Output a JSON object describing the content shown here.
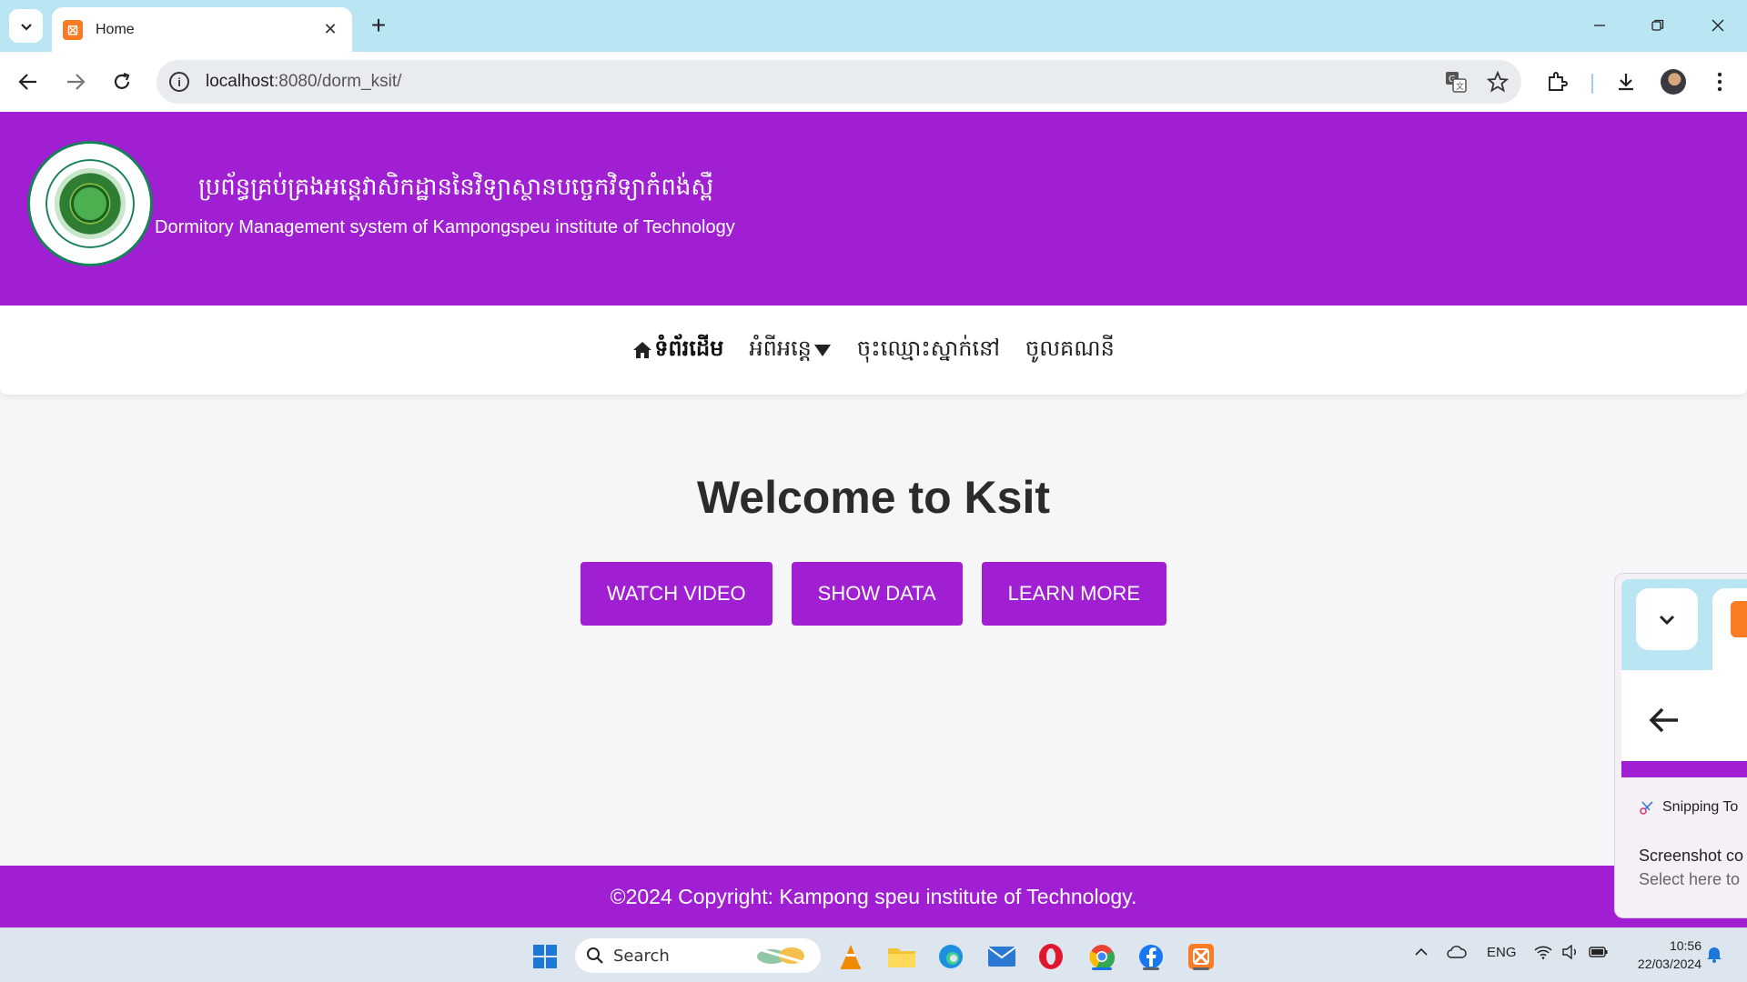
{
  "browser": {
    "tab_title": "Home",
    "url_host": "localhost",
    "url_rest": ":8080/dorm_ksit/",
    "new_tab_glyph": "+",
    "close_glyph": "✕",
    "info_glyph": "i",
    "favicon_glyph": "⊠"
  },
  "site": {
    "title_km": "ប្រព័ន្ធគ្រប់គ្រងអន្តេវាសិកដ្ឋាននៃវិទ្យាស្ថានបច្ចេកវិទ្យាកំពង់ស្ពឺ",
    "title_en": "Dormitory Management system of Kampongspeu institute of Technology",
    "accent_color": "#a11fd3"
  },
  "nav": {
    "home": "ទំព័រដើម",
    "about": "អំពីអន្តេ",
    "register": "ចុះឈ្មោះស្នាក់នៅ",
    "login": "ចូលគណនី"
  },
  "main": {
    "welcome": "Welcome to Ksit",
    "buttons": [
      "WATCH VIDEO",
      "SHOW DATA",
      "LEARN MORE"
    ]
  },
  "footer": {
    "copyright": "©2024 Copyright: Kampong speu institute of Technology."
  },
  "snip_toast": {
    "app_name": "Snipping To",
    "title": "Screenshot co",
    "subtitle": "Select here to"
  },
  "taskbar": {
    "search_label": "Search",
    "lang": "ENG",
    "time": "10:56",
    "date": "22/03/2024"
  }
}
